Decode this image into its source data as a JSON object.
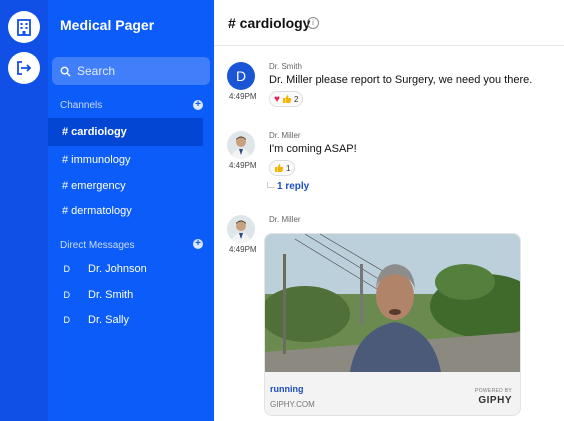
{
  "app": {
    "title": "Medical Pager"
  },
  "rail": {
    "icons": [
      "hospital-icon",
      "logout-icon"
    ]
  },
  "sidebar": {
    "search": {
      "placeholder": "Search"
    },
    "channels_title": "Channels",
    "channels": [
      {
        "label": "# cardiology",
        "active": true
      },
      {
        "label": "# immunology",
        "active": false
      },
      {
        "label": "# emergency",
        "active": false
      },
      {
        "label": "# dermatology",
        "active": false
      }
    ],
    "dm_title": "Direct Messages",
    "dms": [
      {
        "initial": "D",
        "name": "Dr. Johnson"
      },
      {
        "initial": "D",
        "name": "Dr. Smith"
      },
      {
        "initial": "D",
        "name": "Dr. Sally"
      }
    ]
  },
  "header": {
    "channel": "# cardiology",
    "info_icon": "info-icon"
  },
  "messages": [
    {
      "sender": "Dr. Smith",
      "avatar_letter": "D",
      "time": "4:49PM",
      "text": "Dr. Miller please report to Surgery, we need you there.",
      "reactions": [
        "heart",
        "thumbs-up"
      ],
      "reaction_count": "2"
    },
    {
      "sender": "Dr. Miller",
      "time": "4:49PM",
      "text": "I'm coming ASAP!",
      "reactions": [
        "thumbs-up"
      ],
      "reaction_count": "1",
      "reply_label": "1 reply"
    },
    {
      "sender": "Dr. Miller",
      "time": "4:49PM",
      "attachment": {
        "title": "running",
        "source": "GIPHY.COM",
        "powered_by": "POWERED BY",
        "brand": "GIPHY"
      }
    }
  ],
  "colors": {
    "rail": "#1050e6",
    "sidebar": "#0b5cf8",
    "active_channel": "#0446d4",
    "link": "#1a4fbf"
  }
}
